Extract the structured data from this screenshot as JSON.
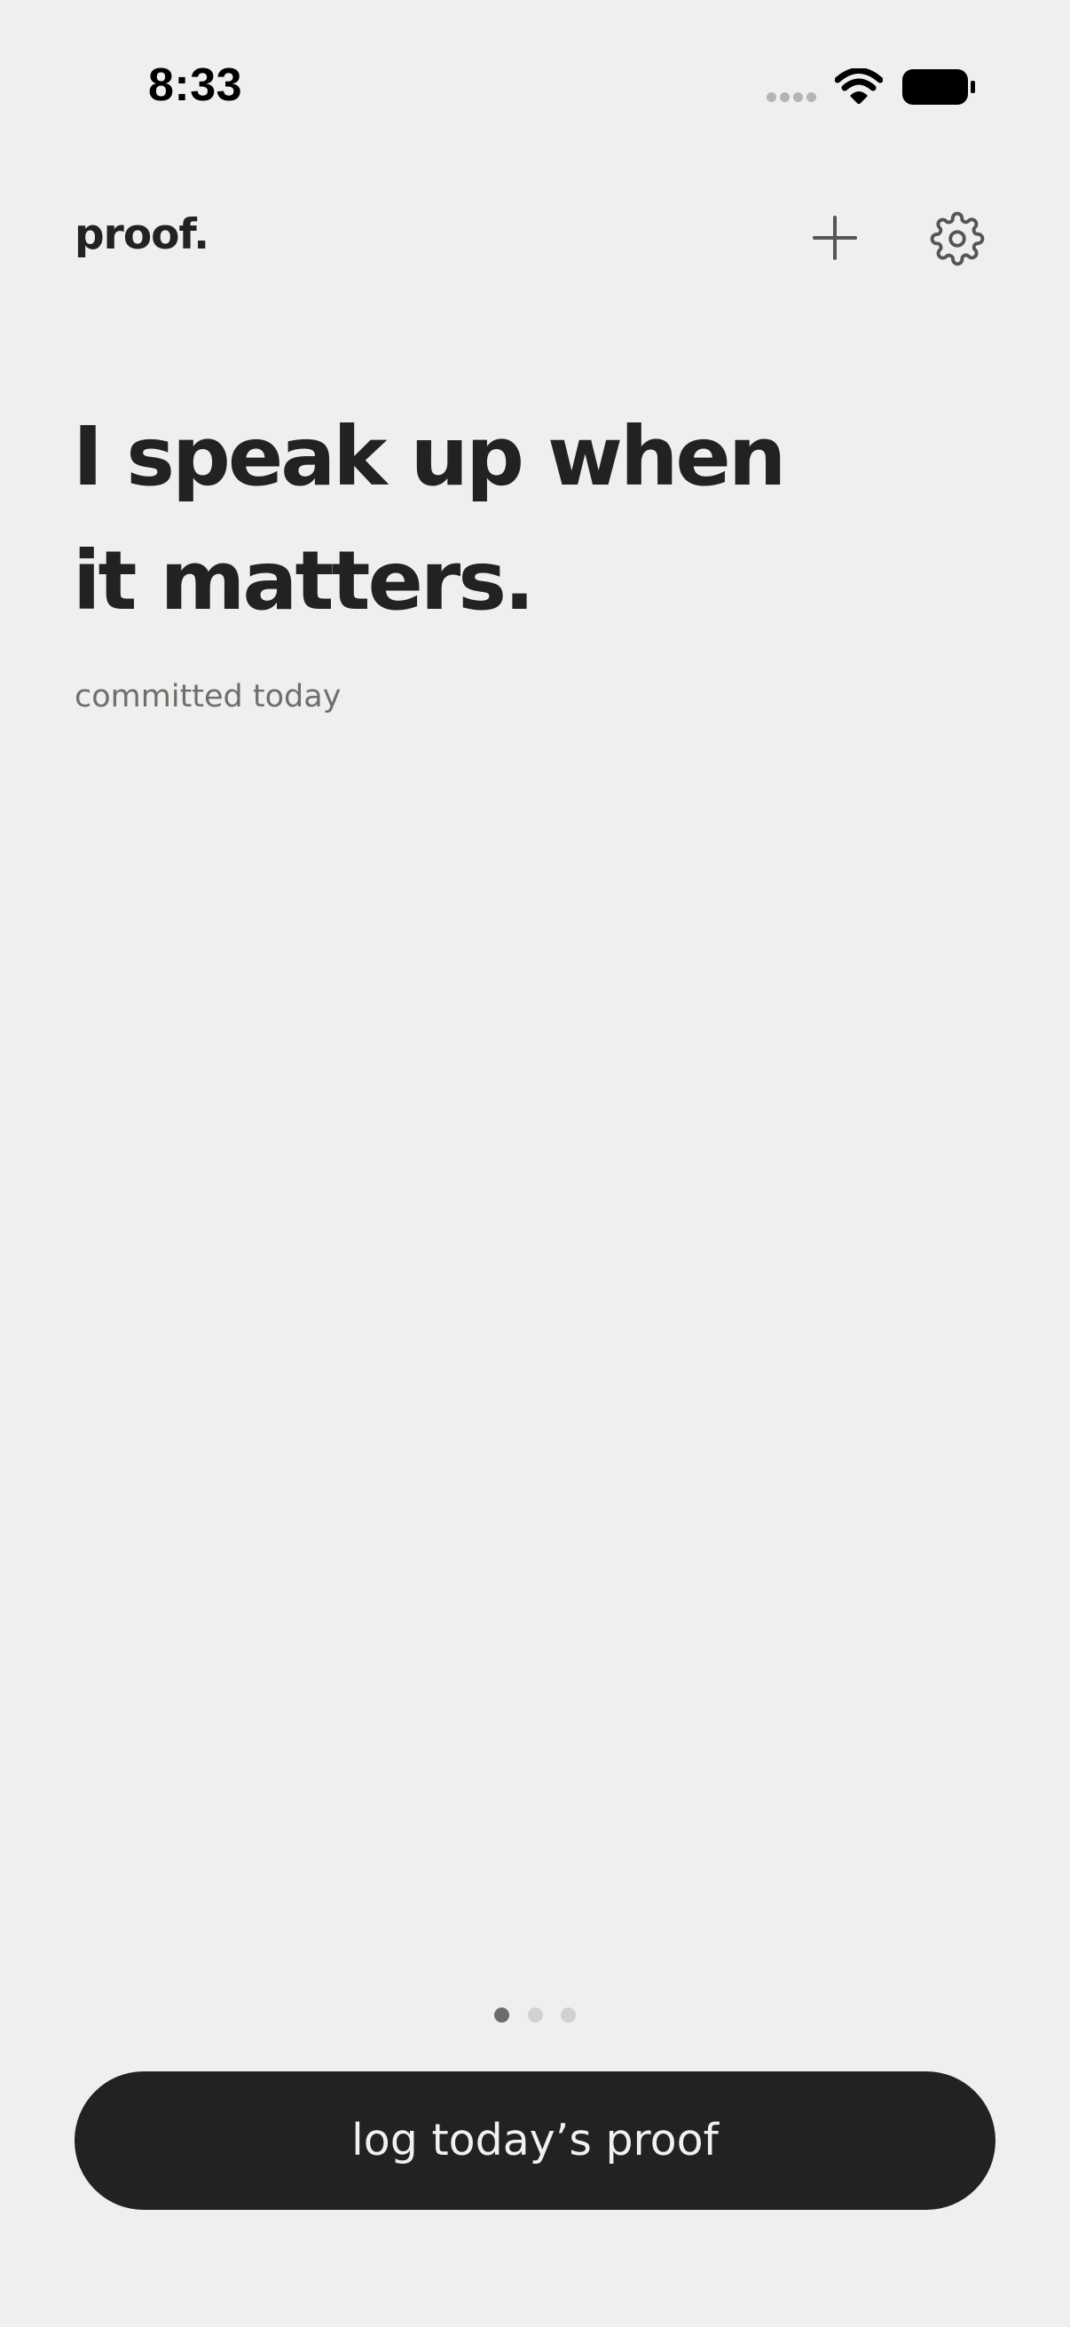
{
  "status_bar": {
    "time": "8:33",
    "signal_icon": "cellular-signal-icon",
    "wifi_icon": "wifi-icon",
    "battery_icon": "battery-icon"
  },
  "header": {
    "logo": "proof.",
    "add_icon": "plus-icon",
    "settings_icon": "gear-icon"
  },
  "main": {
    "headline_line1": "I speak up when",
    "headline_line2": "it matters.",
    "subtitle": "committed today"
  },
  "pager": {
    "page_count": 3,
    "current_page": 1
  },
  "footer": {
    "log_button_label": "log today’s proof"
  },
  "colors": {
    "background": "#f0efed",
    "text_primary": "#222222",
    "text_secondary": "#6e6e6c",
    "button_bg": "#222222",
    "button_text": "#f2f1ef",
    "dot_active": "#6c6c6b",
    "dot_inactive": "#d2d1cf"
  }
}
